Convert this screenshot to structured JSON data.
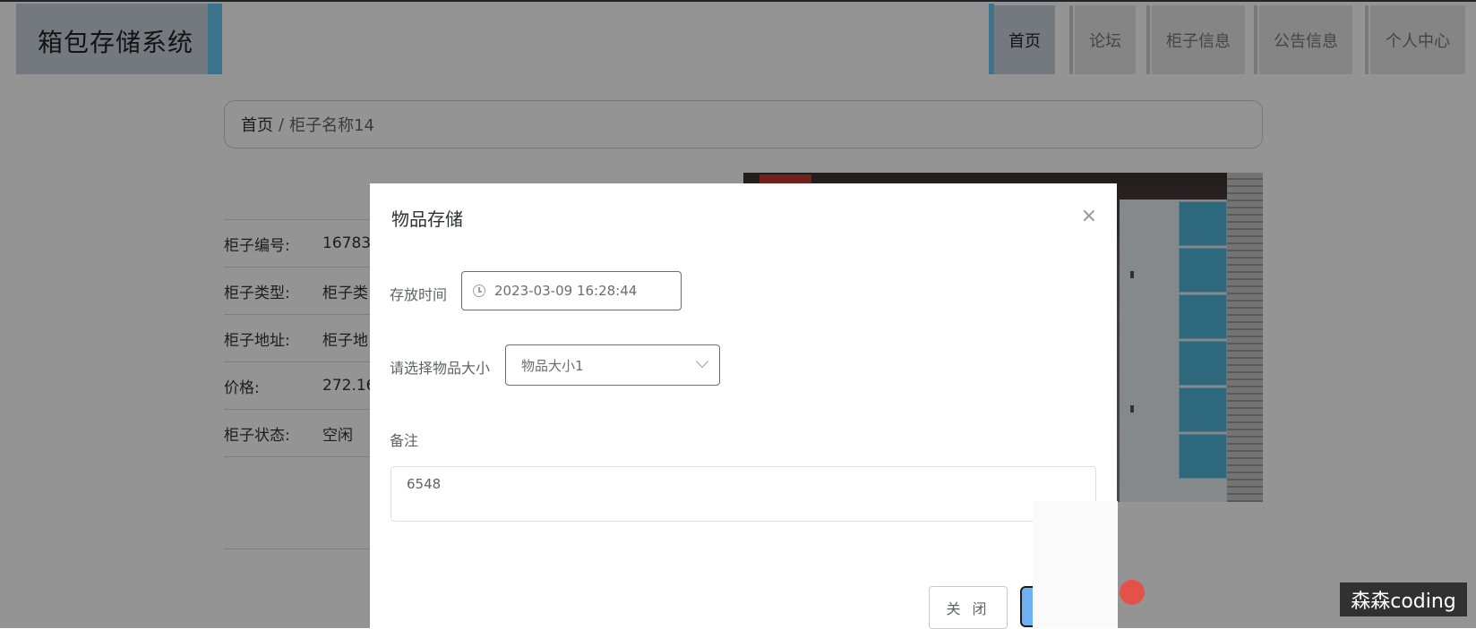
{
  "header": {
    "logo": "箱包存储系统",
    "nav": [
      "首页",
      "论坛",
      "柜子信息",
      "公告信息",
      "个人中心"
    ]
  },
  "breadcrumb": {
    "home": "首页",
    "separator": "/",
    "current": "柜子名称14"
  },
  "details": [
    {
      "label": "柜子编号:",
      "value": "16783"
    },
    {
      "label": "柜子类型:",
      "value": "柜子类"
    },
    {
      "label": "柜子地址:",
      "value": "柜子地"
    },
    {
      "label": "价格:",
      "value": "272.16"
    },
    {
      "label": "柜子状态:",
      "value": "空闲"
    }
  ],
  "modal": {
    "title": "物品存储",
    "close_icon": "×",
    "storage_time_label": "存放时间",
    "storage_time_value": "2023-03-09 16:28:44",
    "size_label": "请选择物品大小",
    "size_value": "物品大小1",
    "remark_label": "备注",
    "remark_value": "6548",
    "close_button": "关 闭"
  },
  "watermark": "森森coding",
  "colors": {
    "accent": "#6cc7f2",
    "nav_active": "#c9cfdb",
    "primary_button": "#6fb0f5"
  }
}
